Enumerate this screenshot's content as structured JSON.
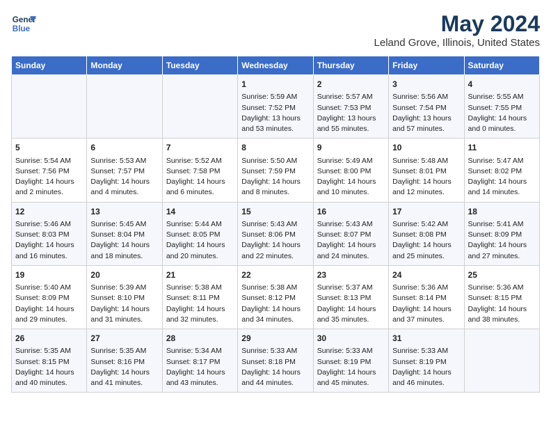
{
  "logo": {
    "line1": "General",
    "line2": "Blue"
  },
  "title": "May 2024",
  "subtitle": "Leland Grove, Illinois, United States",
  "days_of_week": [
    "Sunday",
    "Monday",
    "Tuesday",
    "Wednesday",
    "Thursday",
    "Friday",
    "Saturday"
  ],
  "weeks": [
    [
      {
        "day": "",
        "info": ""
      },
      {
        "day": "",
        "info": ""
      },
      {
        "day": "",
        "info": ""
      },
      {
        "day": "1",
        "info": "Sunrise: 5:59 AM\nSunset: 7:52 PM\nDaylight: 13 hours and 53 minutes."
      },
      {
        "day": "2",
        "info": "Sunrise: 5:57 AM\nSunset: 7:53 PM\nDaylight: 13 hours and 55 minutes."
      },
      {
        "day": "3",
        "info": "Sunrise: 5:56 AM\nSunset: 7:54 PM\nDaylight: 13 hours and 57 minutes."
      },
      {
        "day": "4",
        "info": "Sunrise: 5:55 AM\nSunset: 7:55 PM\nDaylight: 14 hours and 0 minutes."
      }
    ],
    [
      {
        "day": "5",
        "info": "Sunrise: 5:54 AM\nSunset: 7:56 PM\nDaylight: 14 hours and 2 minutes."
      },
      {
        "day": "6",
        "info": "Sunrise: 5:53 AM\nSunset: 7:57 PM\nDaylight: 14 hours and 4 minutes."
      },
      {
        "day": "7",
        "info": "Sunrise: 5:52 AM\nSunset: 7:58 PM\nDaylight: 14 hours and 6 minutes."
      },
      {
        "day": "8",
        "info": "Sunrise: 5:50 AM\nSunset: 7:59 PM\nDaylight: 14 hours and 8 minutes."
      },
      {
        "day": "9",
        "info": "Sunrise: 5:49 AM\nSunset: 8:00 PM\nDaylight: 14 hours and 10 minutes."
      },
      {
        "day": "10",
        "info": "Sunrise: 5:48 AM\nSunset: 8:01 PM\nDaylight: 14 hours and 12 minutes."
      },
      {
        "day": "11",
        "info": "Sunrise: 5:47 AM\nSunset: 8:02 PM\nDaylight: 14 hours and 14 minutes."
      }
    ],
    [
      {
        "day": "12",
        "info": "Sunrise: 5:46 AM\nSunset: 8:03 PM\nDaylight: 14 hours and 16 minutes."
      },
      {
        "day": "13",
        "info": "Sunrise: 5:45 AM\nSunset: 8:04 PM\nDaylight: 14 hours and 18 minutes."
      },
      {
        "day": "14",
        "info": "Sunrise: 5:44 AM\nSunset: 8:05 PM\nDaylight: 14 hours and 20 minutes."
      },
      {
        "day": "15",
        "info": "Sunrise: 5:43 AM\nSunset: 8:06 PM\nDaylight: 14 hours and 22 minutes."
      },
      {
        "day": "16",
        "info": "Sunrise: 5:43 AM\nSunset: 8:07 PM\nDaylight: 14 hours and 24 minutes."
      },
      {
        "day": "17",
        "info": "Sunrise: 5:42 AM\nSunset: 8:08 PM\nDaylight: 14 hours and 25 minutes."
      },
      {
        "day": "18",
        "info": "Sunrise: 5:41 AM\nSunset: 8:09 PM\nDaylight: 14 hours and 27 minutes."
      }
    ],
    [
      {
        "day": "19",
        "info": "Sunrise: 5:40 AM\nSunset: 8:09 PM\nDaylight: 14 hours and 29 minutes."
      },
      {
        "day": "20",
        "info": "Sunrise: 5:39 AM\nSunset: 8:10 PM\nDaylight: 14 hours and 31 minutes."
      },
      {
        "day": "21",
        "info": "Sunrise: 5:38 AM\nSunset: 8:11 PM\nDaylight: 14 hours and 32 minutes."
      },
      {
        "day": "22",
        "info": "Sunrise: 5:38 AM\nSunset: 8:12 PM\nDaylight: 14 hours and 34 minutes."
      },
      {
        "day": "23",
        "info": "Sunrise: 5:37 AM\nSunset: 8:13 PM\nDaylight: 14 hours and 35 minutes."
      },
      {
        "day": "24",
        "info": "Sunrise: 5:36 AM\nSunset: 8:14 PM\nDaylight: 14 hours and 37 minutes."
      },
      {
        "day": "25",
        "info": "Sunrise: 5:36 AM\nSunset: 8:15 PM\nDaylight: 14 hours and 38 minutes."
      }
    ],
    [
      {
        "day": "26",
        "info": "Sunrise: 5:35 AM\nSunset: 8:15 PM\nDaylight: 14 hours and 40 minutes."
      },
      {
        "day": "27",
        "info": "Sunrise: 5:35 AM\nSunset: 8:16 PM\nDaylight: 14 hours and 41 minutes."
      },
      {
        "day": "28",
        "info": "Sunrise: 5:34 AM\nSunset: 8:17 PM\nDaylight: 14 hours and 43 minutes."
      },
      {
        "day": "29",
        "info": "Sunrise: 5:33 AM\nSunset: 8:18 PM\nDaylight: 14 hours and 44 minutes."
      },
      {
        "day": "30",
        "info": "Sunrise: 5:33 AM\nSunset: 8:19 PM\nDaylight: 14 hours and 45 minutes."
      },
      {
        "day": "31",
        "info": "Sunrise: 5:33 AM\nSunset: 8:19 PM\nDaylight: 14 hours and 46 minutes."
      },
      {
        "day": "",
        "info": ""
      }
    ]
  ]
}
